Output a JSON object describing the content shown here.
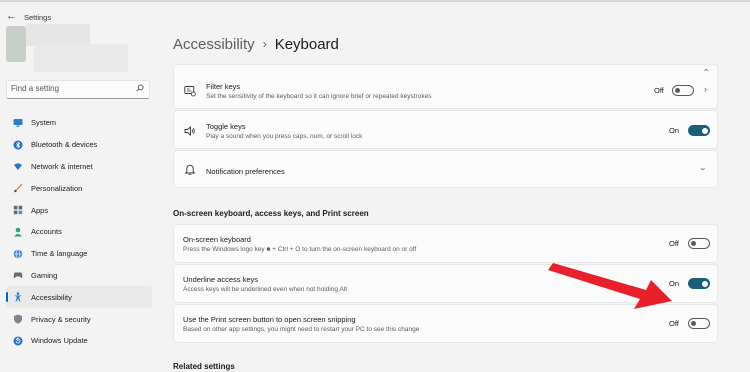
{
  "window": {
    "title": "Settings",
    "back_glyph": "←"
  },
  "search": {
    "placeholder": "Find a setting"
  },
  "sidebar": {
    "items": [
      {
        "label": "System",
        "icon": "monitor-icon"
      },
      {
        "label": "Bluetooth & devices",
        "icon": "bluetooth-icon"
      },
      {
        "label": "Network & internet",
        "icon": "wifi-icon"
      },
      {
        "label": "Personalization",
        "icon": "brush-icon"
      },
      {
        "label": "Apps",
        "icon": "apps-icon"
      },
      {
        "label": "Accounts",
        "icon": "person-icon"
      },
      {
        "label": "Time & language",
        "icon": "globe-icon"
      },
      {
        "label": "Gaming",
        "icon": "gamepad-icon"
      },
      {
        "label": "Accessibility",
        "icon": "accessibility-icon",
        "active": true
      },
      {
        "label": "Privacy & security",
        "icon": "shield-icon"
      },
      {
        "label": "Windows Update",
        "icon": "update-icon"
      }
    ]
  },
  "breadcrumb": {
    "parent": "Accessibility",
    "separator": "›",
    "current": "Keyboard"
  },
  "settings": {
    "filter_keys": {
      "title": "Filter keys",
      "desc": "Set the sensitivity of the keyboard so it can ignore brief or repeated keystrokes",
      "state": "Off"
    },
    "toggle_keys": {
      "title": "Toggle keys",
      "desc": "Play a sound when you press caps, num, or scroll lock",
      "state": "On"
    },
    "notification": {
      "title": "Notification preferences"
    }
  },
  "section_title": "On-screen keyboard, access keys, and Print screen",
  "onscreen": {
    "osk": {
      "title": "On-screen keyboard",
      "desc": "Press the Windows logo key ■ + Ctrl + O to turn the on-screen keyboard on or off",
      "state": "Off"
    },
    "underline": {
      "title": "Underline access keys",
      "desc": "Access keys will be underlined even when not holding Alt",
      "state": "On"
    },
    "printscreen": {
      "title": "Use the Print screen button to open screen snipping",
      "desc": "Based on other app settings, you might need to restart your PC to see this change",
      "state": "Off"
    }
  },
  "related_title": "Related settings",
  "colors": {
    "accent": "#1a5f7a",
    "annotation_arrow": "#e8202a",
    "active_indicator": "#0067c0"
  }
}
